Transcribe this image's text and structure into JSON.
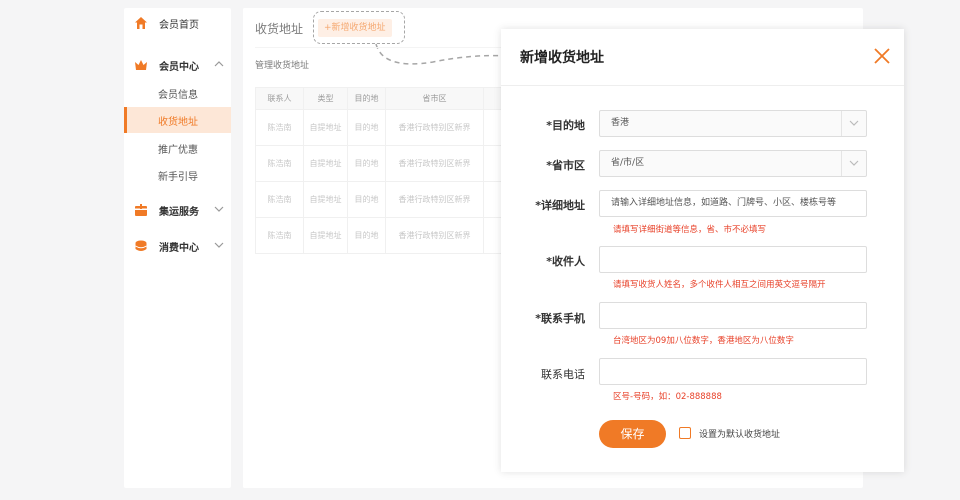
{
  "sidebar": {
    "home": "会员首页",
    "member_center": "会员中心",
    "member_info": "会员信息",
    "shipping_address": "收货地址",
    "promotions": "推广优惠",
    "guide": "新手引导",
    "consolidation": "集运服务",
    "consumption": "消费中心"
  },
  "main": {
    "title": "收货地址",
    "add_button": "+新增收货地址",
    "subtitle": "管理收货地址",
    "columns": [
      "联系人",
      "类型",
      "目的地",
      "省市区"
    ],
    "rows": [
      [
        "陈浩南",
        "自提地址",
        "目的地",
        "香港行政特别区新界"
      ],
      [
        "陈浩南",
        "自提地址",
        "目的地",
        "香港行政特别区新界"
      ],
      [
        "陈浩南",
        "自提地址",
        "目的地",
        "香港行政特别区新界"
      ],
      [
        "陈浩南",
        "自提地址",
        "目的地",
        "香港行政特别区新界"
      ]
    ]
  },
  "dialog": {
    "title": "新增收货地址",
    "destination_label": "*目的地",
    "destination_value": "香港",
    "region_label": "*省市区",
    "region_value": "省/市/区",
    "detail_label": "*详细地址",
    "detail_placeholder": "请输入详细地址信息，如道路、门牌号、小区、楼栋号等",
    "detail_hint": "请填写详细街道等信息，省、市不必填写",
    "receiver_label": "*收件人",
    "receiver_hint": "请填写收货人姓名，多个收件人相互之间用英文逗号隔开",
    "mobile_label": "*联系手机",
    "mobile_hint": "台湾地区为09加八位数字，香港地区为八位数字",
    "phone_label": "联系电话",
    "phone_hint": "区号-号码，如：02-888888",
    "save_button": "保存",
    "default_checkbox_label": "设置为默认收货地址"
  },
  "colors": {
    "accent": "#f07a26",
    "accent_light": "#fde7d7",
    "hint_red": "#e8422a"
  }
}
